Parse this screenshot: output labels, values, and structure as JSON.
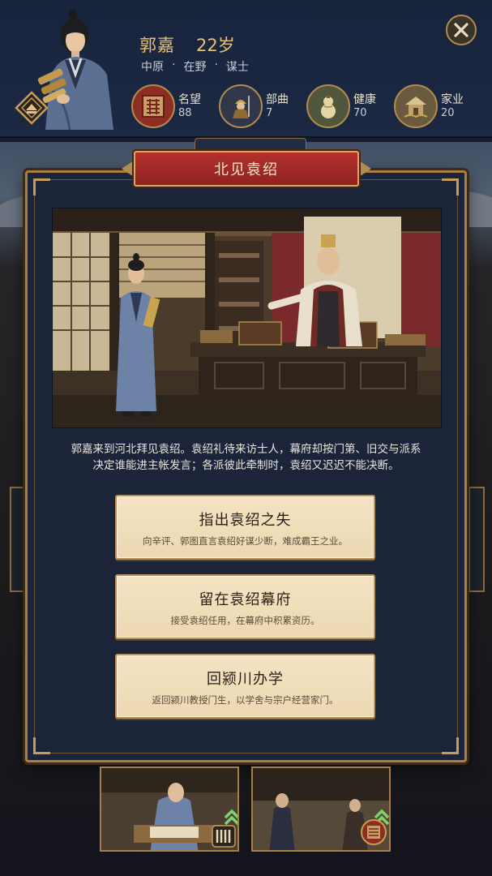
{
  "character": {
    "name": "郭嘉",
    "age": "22岁",
    "tags": [
      "中原",
      "在野",
      "谋士"
    ],
    "separator": "·"
  },
  "stats": [
    {
      "label": "名望",
      "value": "88",
      "icon": "seal-icon"
    },
    {
      "label": "部曲",
      "value": "7",
      "icon": "soldier-icon"
    },
    {
      "label": "健康",
      "value": "70",
      "icon": "gourd-icon"
    },
    {
      "label": "家业",
      "value": "20",
      "icon": "house-icon"
    }
  ],
  "event": {
    "title": "北见袁绍",
    "description_line1": "郭嘉来到河北拜见袁绍。袁绍礼待来访士人，幕府却按门第、旧交与派系",
    "description_line2": "决定谁能进主帐发言；各派彼此牵制时，袁绍又迟迟不能决断。"
  },
  "choices": [
    {
      "title": "指出袁绍之失",
      "desc": "向辛评、郭图直言袁绍好谋少断，难成霸王之业。"
    },
    {
      "title": "留在袁绍幕府",
      "desc": "接受袁绍任用，在幕府中积累资历。"
    },
    {
      "title": "回颍川办学",
      "desc": "返回颍川教授门生，以学舍与宗户经营家门。"
    }
  ],
  "colors": {
    "gold": "#e6c27a",
    "banner_red": "#a42b27",
    "frame": "#a97d45",
    "choice_bg": "#f4e3c3",
    "arrow_green": "#7fd36a"
  }
}
